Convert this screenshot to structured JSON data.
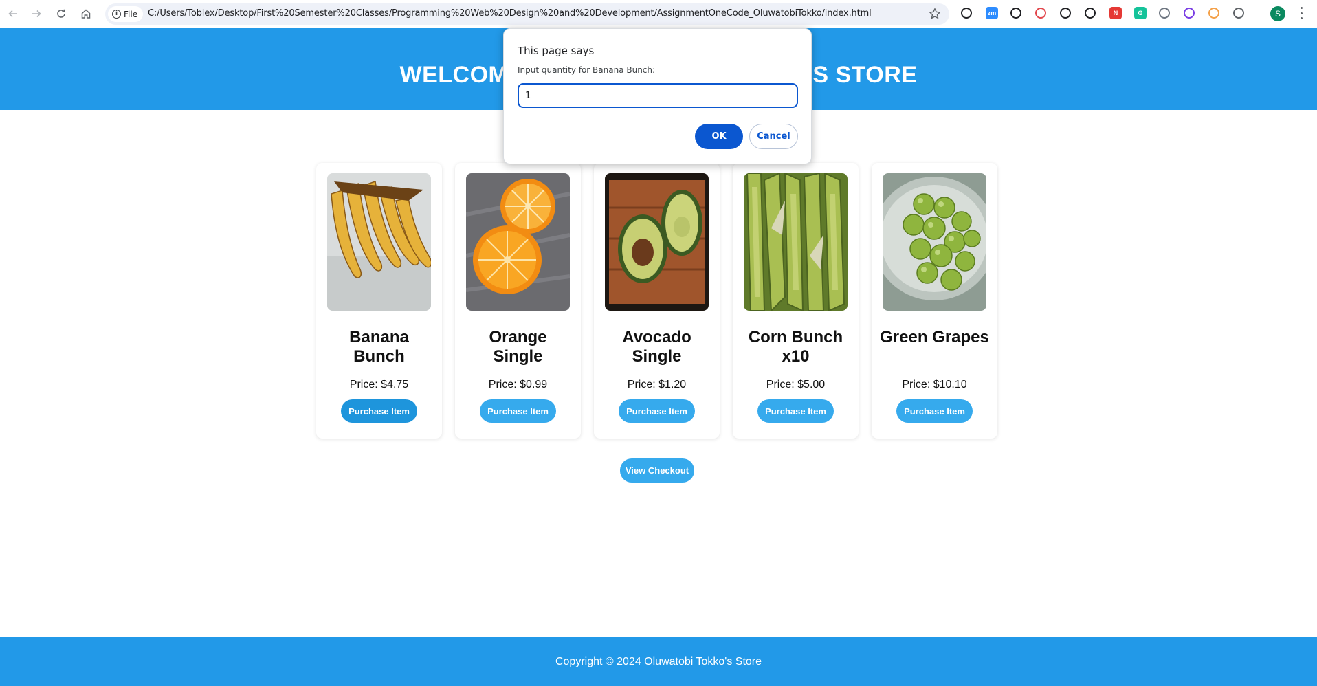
{
  "browser": {
    "security_chip": "File",
    "url": "C:/Users/Toblex/Desktop/First%20Semester%20Classes/Programming%20Web%20Design%20and%20Development/AssignmentOneCode_OluwatobiTokko/index.html",
    "profile_initial": "S",
    "extensions": [
      {
        "name": "ghost-extension-icon",
        "label": "",
        "color": "#202124"
      },
      {
        "name": "zoom-extension-icon",
        "label": "zm",
        "color": "#2d8cff"
      },
      {
        "name": "gift-extension-icon",
        "label": "",
        "color": "#202124"
      },
      {
        "name": "shield-extension-icon",
        "label": "",
        "color": "#e2474d"
      },
      {
        "name": "sync-extension-icon",
        "label": "",
        "color": "#202124"
      },
      {
        "name": "eyedropper-extension-icon",
        "label": "",
        "color": "#202124"
      },
      {
        "name": "n-extension-icon",
        "label": "N",
        "color": "#e53935"
      },
      {
        "name": "grammarly-extension-icon",
        "label": "G",
        "color": "#15c39a"
      },
      {
        "name": "github-extension-icon",
        "label": "",
        "color": "#6e7681"
      },
      {
        "name": "circle-extension-icon",
        "label": "",
        "color": "#7b3fe4"
      },
      {
        "name": "orange-extension-icon",
        "label": "",
        "color": "#f4a14a"
      },
      {
        "name": "puzzle-extensions-icon",
        "label": "",
        "color": "#5f6368"
      }
    ]
  },
  "header": {
    "title": "WELCOME TO OLUWATOBI TOKKO'S STORE"
  },
  "products": [
    {
      "name": "Banana Bunch",
      "price": "Price: $4.75",
      "button": "Purchase Item",
      "image": "banana"
    },
    {
      "name": "Orange Single",
      "price": "Price: $0.99",
      "button": "Purchase Item",
      "image": "orange"
    },
    {
      "name": "Avocado Single",
      "price": "Price: $1.20",
      "button": "Purchase Item",
      "image": "avocado"
    },
    {
      "name": "Corn Bunch x10",
      "price": "Price: $5.00",
      "button": "Purchase Item",
      "image": "corn"
    },
    {
      "name": "Green Grapes",
      "price": "Price: $10.10",
      "button": "Purchase Item",
      "image": "grapes"
    }
  ],
  "checkout_button": "View Checkout",
  "footer": {
    "copyright": "Copyright © 2024 Oluwatobi Tokko's Store"
  },
  "dialog": {
    "title": "This page says",
    "message": "Input quantity for Banana Bunch:",
    "input_value": "1",
    "ok_label": "OK",
    "cancel_label": "Cancel"
  },
  "colors": {
    "brand_blue": "#2299e8",
    "button_blue": "#36aaed",
    "dialog_accent": "#0b57d0"
  }
}
